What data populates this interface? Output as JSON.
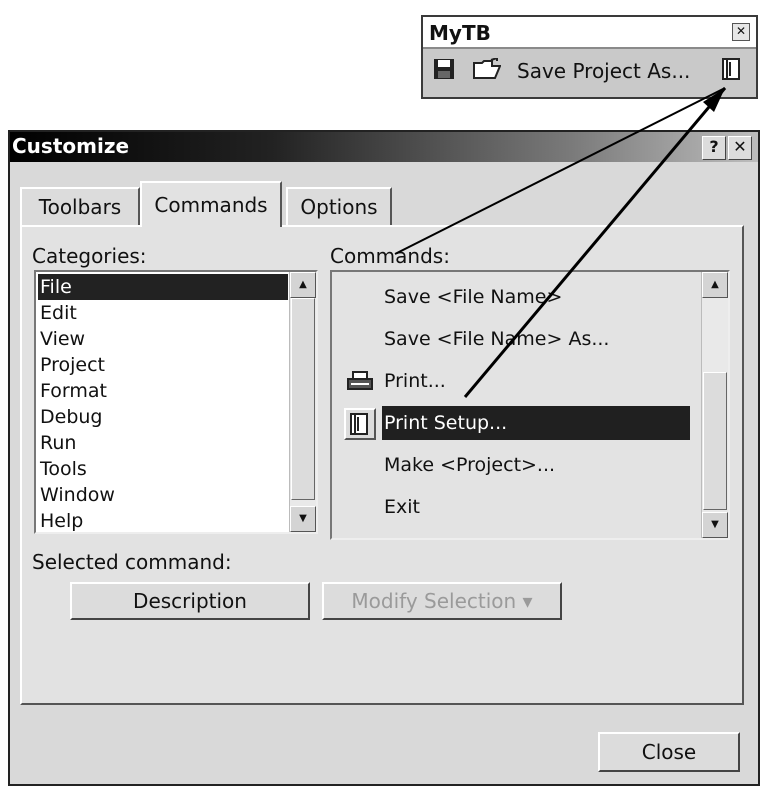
{
  "toolbar": {
    "title": "MyTB",
    "close": "✕",
    "items": [
      {
        "icon": "floppy-disk-icon"
      },
      {
        "icon": "open-folder-icon"
      },
      {
        "label": "Save Project As..."
      },
      {
        "icon": "print-setup-icon"
      }
    ]
  },
  "dialog": {
    "title": "Customize",
    "help": "?",
    "close": "✕",
    "tabs": [
      {
        "label": "Toolbars"
      },
      {
        "label": "Commands"
      },
      {
        "label": "Options"
      }
    ],
    "active_tab": "Commands",
    "categories_label": "Categories:",
    "categories": [
      "File",
      "Edit",
      "View",
      "Project",
      "Format",
      "Debug",
      "Run",
      "Tools",
      "Window",
      "Help"
    ],
    "selected_category": "File",
    "commands_label": "Commands:",
    "commands": [
      {
        "label": "Save <File Name>",
        "icon": ""
      },
      {
        "label": "Save <File Name> As...",
        "icon": ""
      },
      {
        "label": "Print...",
        "icon": "printer-icon"
      },
      {
        "label": "Print Setup...",
        "icon": "print-setup-icon"
      },
      {
        "label": "Make <Project>...",
        "icon": ""
      },
      {
        "label": "Exit",
        "icon": ""
      }
    ],
    "selected_command": "Print Setup...",
    "selected_command_label": "Selected command:",
    "description_button": "Description",
    "modify_selection_button": "Modify Selection ▾",
    "close_button": "Close"
  },
  "colors": {
    "dialog_face": "#d9d9d9",
    "selection": "#202020"
  }
}
